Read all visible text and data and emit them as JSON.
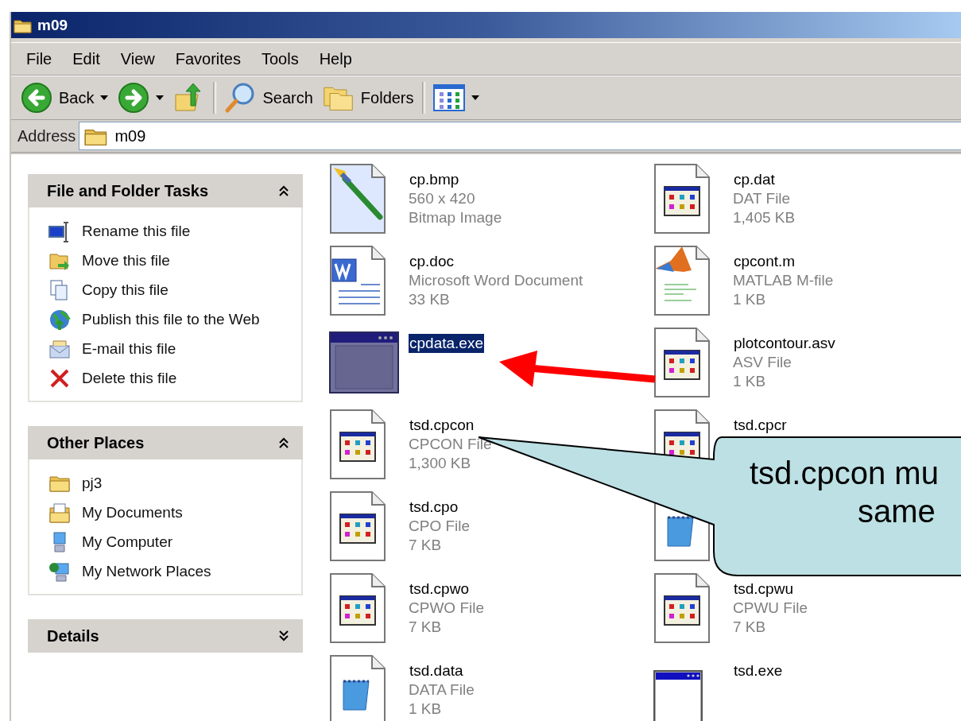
{
  "window": {
    "title": "m09"
  },
  "menu": [
    {
      "label": "File"
    },
    {
      "label": "Edit"
    },
    {
      "label": "View"
    },
    {
      "label": "Favorites"
    },
    {
      "label": "Tools"
    },
    {
      "label": "Help"
    }
  ],
  "toolbar_groups": [
    [
      {
        "kind": "back",
        "label": "Back",
        "dropdown": true
      },
      {
        "kind": "forward",
        "dropdown": true
      },
      {
        "kind": "up",
        "dropdown": false
      }
    ],
    [
      {
        "kind": "search",
        "label": "Search",
        "dropdown": false
      },
      {
        "kind": "folders",
        "label": "Folders",
        "dropdown": false
      }
    ],
    [
      {
        "kind": "views",
        "dropdown": true
      }
    ]
  ],
  "address": {
    "label": "Address",
    "value": "m09"
  },
  "task_panels": [
    {
      "title": "File and Folder Tasks",
      "expanded": true,
      "items": [
        {
          "kind": "rename",
          "label": "Rename this file"
        },
        {
          "kind": "move",
          "label": "Move this file"
        },
        {
          "kind": "copy",
          "label": "Copy this file"
        },
        {
          "kind": "publish",
          "label": "Publish this file to the Web"
        },
        {
          "kind": "email",
          "label": "E-mail this file"
        },
        {
          "kind": "delete",
          "label": "Delete this file"
        }
      ]
    },
    {
      "title": "Other Places",
      "expanded": true,
      "items": [
        {
          "kind": "folder",
          "label": "pj3"
        },
        {
          "kind": "documents",
          "label": "My Documents"
        },
        {
          "kind": "computer",
          "label": "My Computer"
        },
        {
          "kind": "network",
          "label": "My Network Places"
        }
      ]
    },
    {
      "title": "Details",
      "expanded": false
    }
  ],
  "files": [
    {
      "kind": "bitmap",
      "name": "cp.bmp",
      "details": [
        "560 x 420",
        "Bitmap Image"
      ],
      "selected": false
    },
    {
      "kind": "app-file",
      "name": "cp.dat",
      "details": [
        "DAT File",
        "1,405 KB"
      ],
      "selected": false
    },
    {
      "kind": "word",
      "name": "cp.doc",
      "details": [
        "Microsoft Word Document",
        "33 KB"
      ],
      "selected": false
    },
    {
      "kind": "matlab",
      "name": "cpcont.m",
      "details": [
        "MATLAB M-file",
        "1 KB"
      ],
      "selected": false
    },
    {
      "kind": "exe",
      "name": "cpdata.exe",
      "selected": true
    },
    {
      "kind": "app-file",
      "name": "plotcontour.asv",
      "details": [
        "ASV File",
        "1 KB"
      ],
      "selected": false
    },
    {
      "kind": "app-file",
      "name": "tsd.cpcon",
      "details": [
        "CPCON File",
        "1,300 KB"
      ],
      "selected": false
    },
    {
      "kind": "app-file",
      "name": "tsd.cpcr",
      "selected": false
    },
    {
      "kind": "app-file",
      "name": "tsd.cpo",
      "details": [
        "CPO File",
        "7 KB"
      ],
      "selected": false
    },
    {
      "kind": "notepad",
      "selected": false
    },
    {
      "kind": "app-file",
      "name": "tsd.cpwo",
      "details": [
        "CPWO File",
        "7 KB"
      ],
      "selected": false
    },
    {
      "kind": "app-file",
      "name": "tsd.cpwu",
      "details": [
        "CPWU File",
        "7 KB"
      ],
      "selected": false
    },
    {
      "kind": "notepad",
      "name": "tsd.data",
      "details": [
        "DATA File",
        "1 KB"
      ],
      "selected": false
    },
    {
      "kind": "window",
      "name": "tsd.exe",
      "selected": false
    }
  ],
  "callout": {
    "lines": [
      "tsd.cpcon mu",
      "same"
    ]
  }
}
